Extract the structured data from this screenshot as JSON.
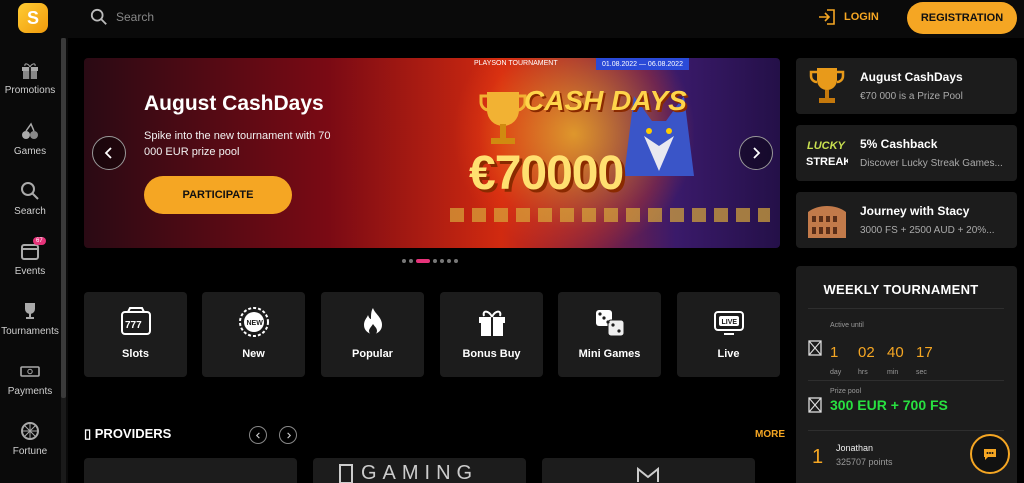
{
  "header": {
    "logo": "S",
    "search_placeholder": "Search",
    "login_label": "LOGIN",
    "register_label": "REGISTRATION",
    "accent_color": "#f5a623"
  },
  "sidebar": {
    "items": [
      {
        "label": "Promotions",
        "icon": "gift-icon"
      },
      {
        "label": "Games",
        "icon": "cherries-icon"
      },
      {
        "label": "Search",
        "icon": "search-icon"
      },
      {
        "label": "Events",
        "icon": "calendar-icon",
        "badge": "67"
      },
      {
        "label": "Tournaments",
        "icon": "trophy-icon"
      },
      {
        "label": "Payments",
        "icon": "cash-icon"
      },
      {
        "label": "Fortune",
        "icon": "wheel-icon"
      }
    ]
  },
  "banner": {
    "title": "August CashDays",
    "description": "Spike into the new tournament with 70 000 EUR prize pool",
    "cta_label": "PARTICIPATE",
    "tournament_tag": "PLAYSON TOURNAMENT",
    "dates": "01.08.2022 — 06.08.2022",
    "art_title": "CASH DAYS",
    "art_amount": "€70000",
    "slide_count": 8,
    "active_slide": 2
  },
  "categories": [
    {
      "label": "Slots",
      "icon": "slot-machine-icon"
    },
    {
      "label": "New",
      "icon": "new-badge-icon"
    },
    {
      "label": "Popular",
      "icon": "flame-icon"
    },
    {
      "label": "Bonus Buy",
      "icon": "gift-icon"
    },
    {
      "label": "Mini Games",
      "icon": "dice-icon"
    },
    {
      "label": "Live",
      "icon": "live-tv-icon"
    }
  ],
  "providers": {
    "title": "PROVIDERS",
    "more_label": "MORE",
    "cards": [
      "",
      "GAMING",
      ""
    ]
  },
  "promos": [
    {
      "title": "August CashDays",
      "subtitle": "€70 000 is a Prize Pool",
      "icon": "trophy-icon"
    },
    {
      "title": "5% Cashback",
      "subtitle": "Discover Lucky Streak Games...",
      "icon": "lucky-streak-logo"
    },
    {
      "title": "Journey with Stacy",
      "subtitle": "3000 FS + 2500 AUD + 20%...",
      "icon": "colosseum-icon"
    }
  ],
  "weekly_tournament": {
    "title": "WEEKLY TOURNAMENT",
    "active_until_label": "Active until",
    "countdown": [
      {
        "value": "1",
        "unit": "day"
      },
      {
        "value": "02",
        "unit": "hrs"
      },
      {
        "value": "40",
        "unit": "min"
      },
      {
        "value": "17",
        "unit": "sec"
      }
    ],
    "prize_pool_label": "Prize pool",
    "prize_pool": "300 EUR + 700 FS",
    "leaderboard": [
      {
        "rank": "1",
        "name": "Jonathan",
        "points": "325707 points"
      }
    ]
  }
}
